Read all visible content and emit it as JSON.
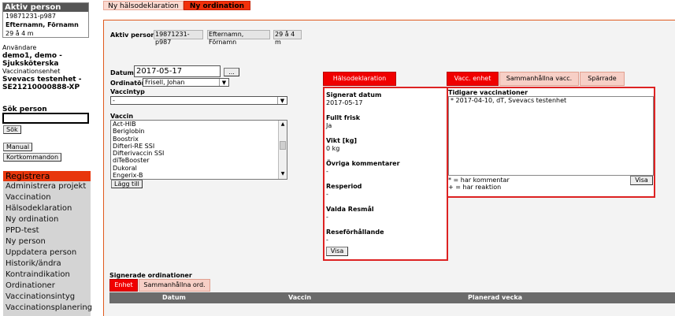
{
  "sidebar": {
    "active_person": {
      "title": "Aktiv person",
      "id": "19871231-p987",
      "name": "Efternamn, Förnamn",
      "age": "29 å 4 m"
    },
    "user": {
      "label": "Användare",
      "name": "demo1, demo -",
      "role": "Sjuksköterska",
      "unit_label": "Vaccinationsenhet",
      "unit_name": "Svevacs testenhet -",
      "unit_code": "SE21210000888-XP"
    },
    "search": {
      "label": "Sök person",
      "value": "",
      "button": "Sök"
    },
    "manual_button": "Manual",
    "shortcuts_button": "Kortkommandon",
    "menu_header": "Registrera",
    "menu_items": [
      "Administrera projekt",
      "Vaccination",
      "Hälsodeklaration",
      "Ny ordination",
      "PPD-test",
      "Ny person",
      "Uppdatera person",
      "Historik/ändra",
      "Kontraindikation",
      "Ordinationer",
      "Vaccinationsintyg",
      "Vaccinationsplanering"
    ]
  },
  "tabs": {
    "health": "Ny hälsodeklaration",
    "order": "Ny ordination"
  },
  "main": {
    "active_person_label": "Aktiv person",
    "active_id": "19871231-p987",
    "active_name": "Efternamn, Förnamn",
    "active_age": "29 å 4 m",
    "date_label": "Datum",
    "date_value": "2017-05-17",
    "date_button": "...",
    "ordinator_label": "Ordinatör",
    "ordinator_value": "Frisell, Johan",
    "vaccintyp_label": "Vaccintyp",
    "vaccintyp_value": "-",
    "vaccin_label": "Vaccin",
    "vaccin_list": [
      "Act-HIB",
      "Beriglobin",
      "Boostrix",
      "Difteri-RE SSI",
      "Difterivaccin SSI",
      "diTeBooster",
      "Dukoral",
      "Engerix-B"
    ],
    "add_button": "Lägg till"
  },
  "health_panel": {
    "tab": "Hälsodeklaration",
    "fields": [
      {
        "label": "Signerat datum",
        "value": "2017-05-17"
      },
      {
        "label": "Fullt frisk",
        "value": "Ja"
      },
      {
        "label": "Vikt [kg]",
        "value": "0 kg"
      },
      {
        "label": "Övriga kommentarer",
        "value": "-"
      },
      {
        "label": "Resperiod",
        "value": "-"
      },
      {
        "label": "Valda Resmål",
        "value": "-"
      },
      {
        "label": "Reseförhållande",
        "value": "-"
      }
    ],
    "show_button": "Visa"
  },
  "vacc_panel": {
    "tabs": [
      "Vacc. enhet",
      "Sammanhållna vacc.",
      "Spärrade"
    ],
    "title": "Tidigare vaccinationer",
    "entries": [
      "* 2017-04-10, dT, Svevacs testenhet"
    ],
    "legend_comment": "* = har kommentar",
    "legend_reaction": "+ = har reaktion",
    "show_button": "Visa"
  },
  "signed": {
    "title": "Signerade ordinationer",
    "tabs": [
      "Enhet",
      "Sammanhållna ord."
    ],
    "columns": [
      "Datum",
      "Vaccin",
      "Planerad vecka"
    ]
  }
}
